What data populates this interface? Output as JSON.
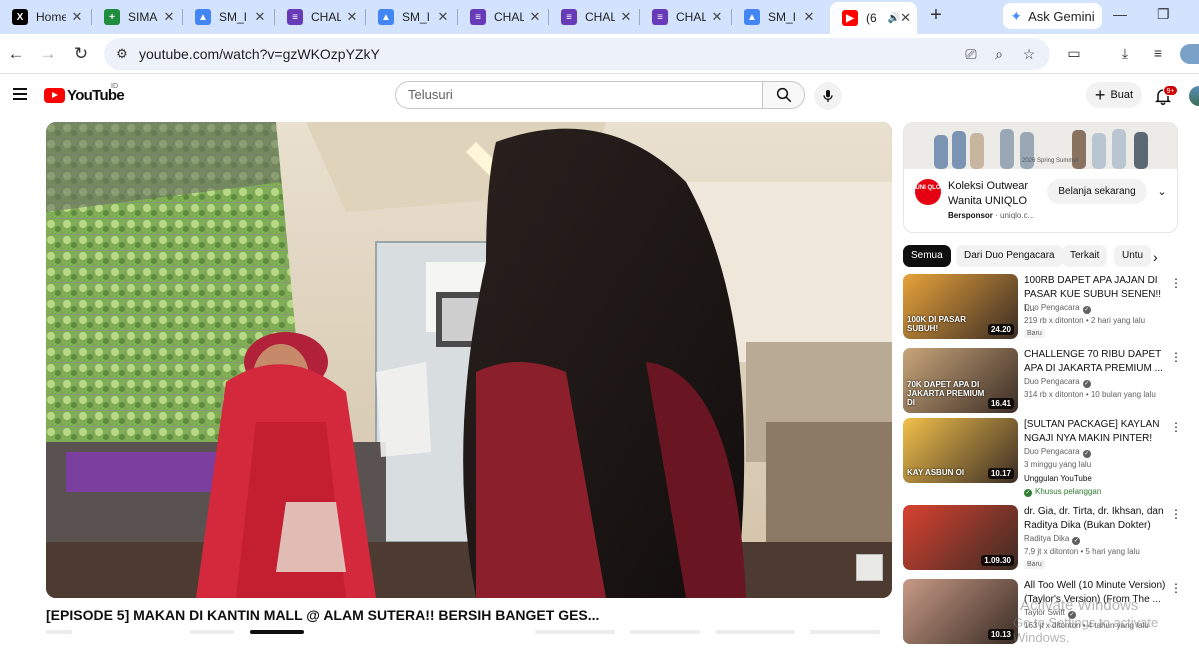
{
  "browser": {
    "tabs": [
      {
        "label": "Home",
        "icon": "x-logo-icon",
        "color": "#000000",
        "glyph": "X"
      },
      {
        "label": "SIMA",
        "icon": "sheets-icon",
        "color": "#1e8e3e",
        "glyph": "+"
      },
      {
        "label": "SM_I",
        "icon": "drive-icon",
        "color": "#4285f4",
        "glyph": "▲"
      },
      {
        "label": "CHAL",
        "icon": "forms-icon",
        "color": "#673ab7",
        "glyph": "≡"
      },
      {
        "label": "SM_I",
        "icon": "drive-icon",
        "color": "#4285f4",
        "glyph": "▲"
      },
      {
        "label": "CHAL",
        "icon": "forms-icon",
        "color": "#673ab7",
        "glyph": "≡"
      },
      {
        "label": "CHAL",
        "icon": "forms-icon",
        "color": "#673ab7",
        "glyph": "≡"
      },
      {
        "label": "CHAL",
        "icon": "forms-icon",
        "color": "#673ab7",
        "glyph": "≡"
      },
      {
        "label": "SM_I",
        "icon": "drive-icon",
        "color": "#4285f4",
        "glyph": "▲"
      },
      {
        "label": "(6",
        "icon": "youtube-icon",
        "color": "#ff0000",
        "glyph": "▶",
        "active": true
      }
    ],
    "gemini_label": "Ask Gemini",
    "url": "youtube.com/watch?v=gzWKOzpYZkY"
  },
  "youtube": {
    "logo_text": "YouTube",
    "country": "ID",
    "search_placeholder": "Telusuri",
    "create_label": "Buat",
    "notif_count": "9+"
  },
  "video": {
    "title": "[EPISODE 5] MAKAN DI KANTIN MALL @ ALAM SUTERA!! BERSIH BANGET GES..."
  },
  "ad": {
    "logo_text": "UNI QLO",
    "title": "Koleksi Outwear Wanita UNIQLO",
    "sponsor": "Bersponsor",
    "domain": "uniqlo.c...",
    "cta": "Belanja sekarang",
    "banner_text": "2026 Spring Summer"
  },
  "chips": [
    "Semua",
    "Dari Duo Pengacara",
    "Terkait",
    "Untu"
  ],
  "recommendations": [
    {
      "title": "100RB DAPET APA JAJAN DI PASAR KUE SUBUH SENEN!! I...",
      "channel": "Duo Pengacara",
      "meta": "219 rb x ditonton • 2 hari yang lalu",
      "badge": "Baru",
      "duration": "24.20",
      "thumb_text": "100K DI PASAR SUBUH!",
      "thumb_color": "#e8a33a"
    },
    {
      "title": "CHALLENGE 70 RIBU DAPET APA DI JAKARTA PREMIUM ...",
      "channel": "Duo Pengacara",
      "meta": "314 rb x ditonton • 10 bulan yang lalu",
      "duration": "16.41",
      "thumb_text": "70K DAPET APA DI JAKARTA PREMIUM DI",
      "thumb_color": "#c9a67a"
    },
    {
      "title": "[SULTAN PACKAGE] KAYLAN NGAJI NYA MAKIN PINTER!",
      "channel": "Duo Pengacara",
      "meta": "3 minggu yang lalu",
      "note": "Unggulan YouTube",
      "member": "Khusus pelanggan",
      "duration": "10.17",
      "thumb_text": "KAY ASBUN OI",
      "thumb_color": "#f2c04a"
    },
    {
      "title": "dr. Gia, dr. Tirta, dr. Ikhsan, dan Raditya Dika (Bukan Dokter)",
      "channel": "Raditya Dika",
      "meta": "7,9 jt x ditonton • 5 hari yang lalu",
      "badge": "Baru",
      "duration": "1.09.30",
      "thumb_text": "",
      "thumb_color": "#d9412f"
    },
    {
      "title": "All Too Well (10 Minute Version) (Taylor's Version) (From The ...",
      "channel": "Taylor Swift",
      "meta": "163 jt x ditonton • 4 tahun yang lalu",
      "duration": "10.13",
      "thumb_text": "",
      "thumb_color": "#c89a86"
    }
  ],
  "watermark": {
    "line1": "Activate Windows",
    "line2": "Go to Settings to activate Windows."
  }
}
